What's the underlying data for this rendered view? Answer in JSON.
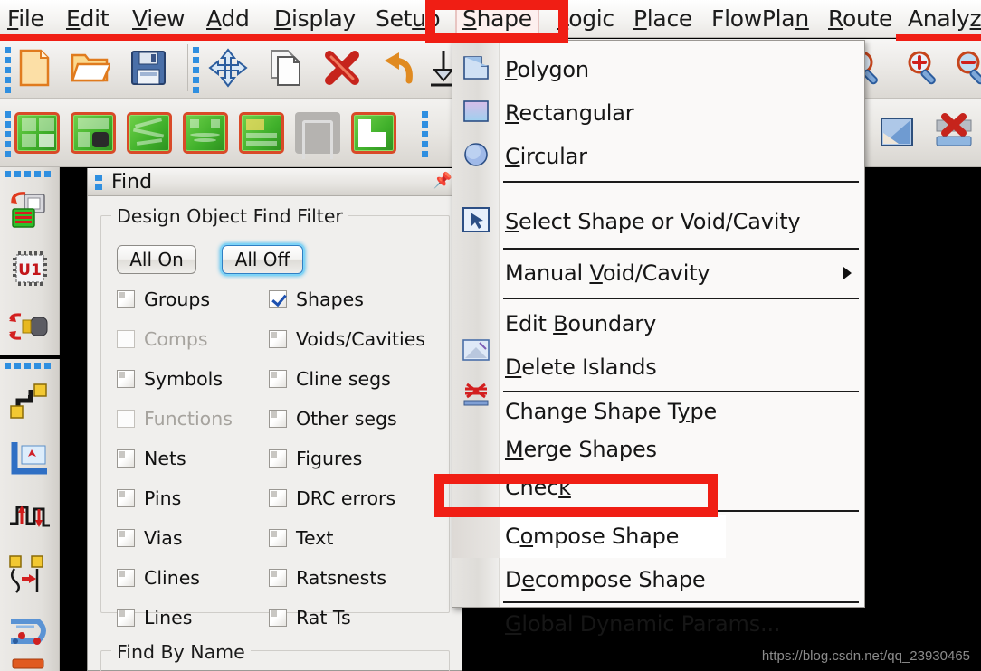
{
  "menubar": {
    "items": [
      {
        "label": "File",
        "mnemonic": "F",
        "selected": false
      },
      {
        "label": "Edit",
        "mnemonic": "E",
        "selected": false
      },
      {
        "label": "View",
        "mnemonic": "V",
        "selected": false
      },
      {
        "label": "Add",
        "mnemonic": "A",
        "selected": false
      },
      {
        "label": "Display",
        "mnemonic": "D",
        "selected": false
      },
      {
        "label": "Setup",
        "mnemonic": "u",
        "selected": false
      },
      {
        "label": "Shape",
        "mnemonic": "S",
        "selected": true
      },
      {
        "label": "Logic",
        "mnemonic": "L",
        "selected": false
      },
      {
        "label": "Place",
        "mnemonic": "P",
        "selected": false
      },
      {
        "label": "FlowPlan",
        "mnemonic": "n",
        "selected": false
      },
      {
        "label": "Route",
        "mnemonic": "R",
        "selected": false
      },
      {
        "label": "Analyze",
        "mnemonic": "z",
        "selected": false
      }
    ]
  },
  "toolbar1": {
    "icons": [
      {
        "name": "new-file-icon"
      },
      {
        "name": "open-folder-icon"
      },
      {
        "name": "save-disk-icon"
      },
      {
        "name": "move-icon"
      },
      {
        "name": "copy-icon"
      },
      {
        "name": "delete-x-icon"
      },
      {
        "name": "undo-icon"
      },
      {
        "name": "download-icon"
      },
      {
        "name": "zoom-fit-icon"
      },
      {
        "name": "zoom-in-icon"
      },
      {
        "name": "zoom-out-icon"
      }
    ]
  },
  "toolbar2": {
    "icons": [
      {
        "name": "shape-add-rect-icon"
      },
      {
        "name": "shape-add-text-icon"
      },
      {
        "name": "shape-edit-icon"
      },
      {
        "name": "shape-boundary-icon"
      },
      {
        "name": "shape-layers-icon"
      },
      {
        "name": "shape-disabled-icon"
      },
      {
        "name": "shape-compose-icon"
      },
      {
        "name": "shape-select-icon"
      },
      {
        "name": "shape-delete-icon"
      }
    ]
  },
  "leftstrip": {
    "group_a": [
      {
        "name": "swap-components-icon"
      },
      {
        "name": "chip-u1-icon"
      },
      {
        "name": "pin-swap-icon"
      }
    ],
    "group_b": [
      {
        "name": "add-connect-icon"
      },
      {
        "name": "route-corner-icon"
      },
      {
        "name": "delay-tune-icon"
      },
      {
        "name": "slide-route-icon"
      },
      {
        "name": "fanout-icon"
      },
      {
        "name": "misc-tool-icon"
      }
    ]
  },
  "find_panel": {
    "title": "Find",
    "pin_icon": "pin-icon",
    "filter_group_legend": "Design Object Find Filter",
    "buttons": [
      {
        "label": "All On",
        "focused": false
      },
      {
        "label": "All Off",
        "focused": true
      }
    ],
    "checkboxes_left": [
      {
        "label": "Groups",
        "checked": false,
        "enabled": true
      },
      {
        "label": "Comps",
        "checked": false,
        "enabled": false
      },
      {
        "label": "Symbols",
        "checked": false,
        "enabled": true
      },
      {
        "label": "Functions",
        "checked": false,
        "enabled": false
      },
      {
        "label": "Nets",
        "checked": false,
        "enabled": true
      },
      {
        "label": "Pins",
        "checked": false,
        "enabled": true
      },
      {
        "label": "Vias",
        "checked": false,
        "enabled": true
      },
      {
        "label": "Clines",
        "checked": false,
        "enabled": true
      },
      {
        "label": "Lines",
        "checked": false,
        "enabled": true
      }
    ],
    "checkboxes_right": [
      {
        "label": "Shapes",
        "checked": true,
        "enabled": true
      },
      {
        "label": "Voids/Cavities",
        "checked": false,
        "enabled": true
      },
      {
        "label": "Cline segs",
        "checked": false,
        "enabled": true
      },
      {
        "label": "Other segs",
        "checked": false,
        "enabled": true
      },
      {
        "label": "Figures",
        "checked": false,
        "enabled": true
      },
      {
        "label": "DRC errors",
        "checked": false,
        "enabled": true
      },
      {
        "label": "Text",
        "checked": false,
        "enabled": true
      },
      {
        "label": "Ratsnests",
        "checked": false,
        "enabled": true
      },
      {
        "label": "Rat Ts",
        "checked": false,
        "enabled": true
      }
    ],
    "find_by_name_legend": "Find By Name"
  },
  "dropdown": {
    "parent": "Shape",
    "items": [
      {
        "label": "Polygon",
        "mnemonic": "P",
        "icon": "polygon-shape-icon",
        "has_icon": true,
        "highlighted": false,
        "submenu": false,
        "sep_after": false
      },
      {
        "label": "Rectangular",
        "mnemonic": "R",
        "icon": "rectangle-shape-icon",
        "has_icon": true,
        "highlighted": false,
        "submenu": false,
        "sep_after": false
      },
      {
        "label": "Circular",
        "mnemonic": "C",
        "icon": "circle-shape-icon",
        "has_icon": true,
        "highlighted": false,
        "submenu": false,
        "sep_after": true
      },
      {
        "label": "Select Shape or Void/Cavity",
        "mnemonic": "S",
        "icon": "cursor-select-icon",
        "has_icon": true,
        "highlighted": false,
        "submenu": false,
        "sep_after": true
      },
      {
        "label": "Manual Void/Cavity",
        "mnemonic": "V",
        "icon": "",
        "has_icon": false,
        "highlighted": false,
        "submenu": true,
        "sep_after": true
      },
      {
        "label": "Edit Boundary",
        "mnemonic": "B",
        "icon": "edit-boundary-icon",
        "has_icon": true,
        "highlighted": false,
        "submenu": false,
        "sep_after": false
      },
      {
        "label": "Delete Islands",
        "mnemonic": "D",
        "icon": "delete-islands-icon",
        "has_icon": true,
        "highlighted": false,
        "submenu": false,
        "sep_after": true
      },
      {
        "label": "Change Shape Type",
        "mnemonic": "y",
        "icon": "",
        "has_icon": false,
        "highlighted": false,
        "submenu": false,
        "sep_after": false
      },
      {
        "label": "Merge Shapes",
        "mnemonic": "M",
        "icon": "",
        "has_icon": false,
        "highlighted": false,
        "submenu": false,
        "sep_after": false
      },
      {
        "label": "Check",
        "mnemonic": "k",
        "icon": "",
        "has_icon": false,
        "highlighted": false,
        "submenu": false,
        "sep_after": true
      },
      {
        "label": "Compose Shape",
        "mnemonic": "o",
        "icon": "",
        "has_icon": false,
        "highlighted": true,
        "submenu": false,
        "sep_after": false
      },
      {
        "label": "Decompose Shape",
        "mnemonic": "e",
        "icon": "",
        "has_icon": false,
        "highlighted": false,
        "submenu": false,
        "sep_after": true
      },
      {
        "label": "Global Dynamic Params...",
        "mnemonic": "G",
        "icon": "",
        "has_icon": false,
        "highlighted": false,
        "submenu": false,
        "sep_after": false
      }
    ]
  },
  "annotations": [
    {
      "name": "shape-menu-highlight",
      "color": "#f01e14"
    },
    {
      "name": "compose-shape-highlight",
      "color": "#f01e14"
    }
  ],
  "watermark": {
    "text": "https://blog.csdn.net/qq_23930465"
  },
  "colors": {
    "annotation_red": "#f01e14",
    "panel_bg": "#f0efed",
    "menu_bg": "#faf9f8",
    "canvas_black": "#000000",
    "focus_blue": "#39b8ef",
    "grip_blue": "#2f8fe0"
  }
}
